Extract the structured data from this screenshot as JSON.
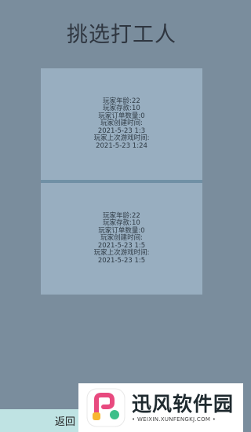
{
  "page": {
    "title": "挑选打工人"
  },
  "cards": [
    {
      "lines": [
        "玩家年龄:22",
        "玩家存款:10",
        "玩家订单数量:0",
        "玩家创建时间:",
        "2021-5-23 1:3",
        "玩家上次游戏时间:",
        "2021-5-23 1:24"
      ]
    },
    {
      "lines": [
        "玩家年龄:22",
        "玩家存款:10",
        "玩家订单数量:0",
        "玩家创建时间:",
        "2021-5-23 1:5",
        "玩家上次游戏时间:",
        "2021-5-23 1:5"
      ]
    }
  ],
  "back_button": {
    "label": "返回"
  },
  "watermark": {
    "title": "迅风软件园",
    "subtitle": "• WEIXIN.XUNFENGKJ.COM •"
  },
  "colors": {
    "background": "#7a8d9d",
    "card": "#98aec0",
    "back_button_bg": "#bfe3e3"
  }
}
